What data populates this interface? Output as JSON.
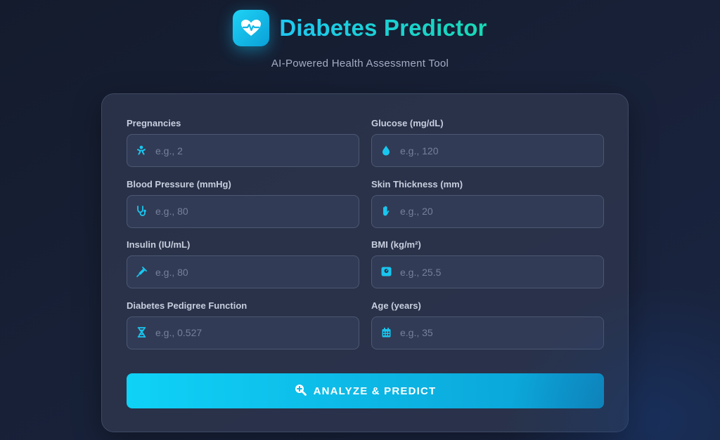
{
  "header": {
    "title": "Diabetes Predictor",
    "subtitle": "AI-Powered Health Assessment Tool",
    "logo_icon": "heart-pulse-icon"
  },
  "colors": {
    "accent": "#12c6f0",
    "accent_dark": "#0a9ed4",
    "title_gradient_end": "#19d8b4",
    "background": "#161e32",
    "card": "#2c354c",
    "input_bg": "#323b55",
    "placeholder": "#75809a"
  },
  "form": {
    "fields": [
      {
        "label": "Pregnancies",
        "placeholder": "e.g., 2",
        "value": "",
        "icon": "baby-icon"
      },
      {
        "label": "Glucose (mg/dL)",
        "placeholder": "e.g., 120",
        "value": "",
        "icon": "droplet-icon"
      },
      {
        "label": "Blood Pressure (mmHg)",
        "placeholder": "e.g., 80",
        "value": "",
        "icon": "stethoscope-icon"
      },
      {
        "label": "Skin Thickness (mm)",
        "placeholder": "e.g., 20",
        "value": "",
        "icon": "hand-icon"
      },
      {
        "label": "Insulin (IU/mL)",
        "placeholder": "e.g., 80",
        "value": "",
        "icon": "syringe-icon"
      },
      {
        "label": "BMI (kg/m²)",
        "placeholder": "e.g., 25.5",
        "value": "",
        "icon": "weight-scale-icon"
      },
      {
        "label": "Diabetes Pedigree Function",
        "placeholder": "e.g., 0.527",
        "value": "",
        "icon": "dna-icon"
      },
      {
        "label": "Age (years)",
        "placeholder": "e.g., 35",
        "value": "",
        "icon": "calendar-icon"
      }
    ],
    "submit_label": "ANALYZE & PREDICT",
    "submit_icon": "magnifier-plus-icon"
  }
}
